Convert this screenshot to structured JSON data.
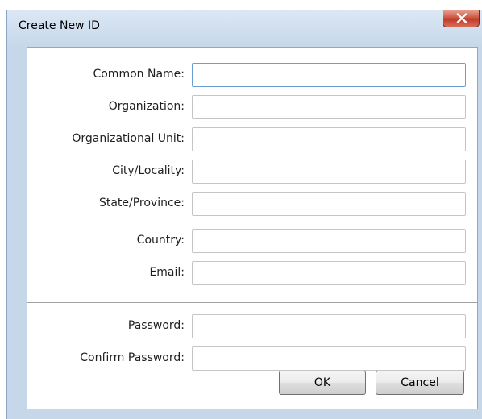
{
  "window": {
    "title": "Create New ID",
    "close_label": "Close"
  },
  "form": {
    "fields": [
      {
        "label": "Common Name:",
        "value": "",
        "focused": true
      },
      {
        "label": "Organization:",
        "value": ""
      },
      {
        "label": "Organizational Unit:",
        "value": ""
      },
      {
        "label": "City/Locality:",
        "value": ""
      },
      {
        "label": "State/Province:",
        "value": ""
      },
      {
        "label": "Country:",
        "value": ""
      },
      {
        "label": "Email:",
        "value": ""
      },
      {
        "label": "Password:",
        "value": ""
      },
      {
        "label": "Confirm Password:",
        "value": ""
      }
    ]
  },
  "buttons": {
    "ok_label": "OK",
    "cancel_label": "Cancel"
  },
  "colors": {
    "frame": "#c6d7ea",
    "close_button": "#c0392b",
    "focus_border": "#6b9fd3"
  },
  "icons": {
    "close": "close-x-icon"
  }
}
